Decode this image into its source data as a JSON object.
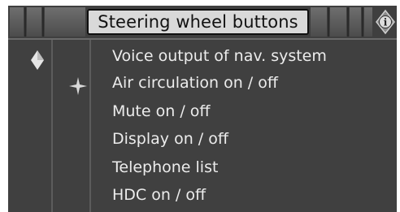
{
  "header": {
    "title": "Steering wheel buttons",
    "info_icon_glyph": "i"
  },
  "menu": {
    "items": [
      {
        "label": "Voice output of nav. system"
      },
      {
        "label": "Air circulation on / off"
      },
      {
        "label": "Mute on / off"
      },
      {
        "label": "Display on / off"
      },
      {
        "label": "Telephone list"
      },
      {
        "label": "HDC on / off"
      }
    ]
  },
  "icons": {
    "diamond": "diamond-icon",
    "star": "four-point-star-icon",
    "info": "info-icon"
  }
}
